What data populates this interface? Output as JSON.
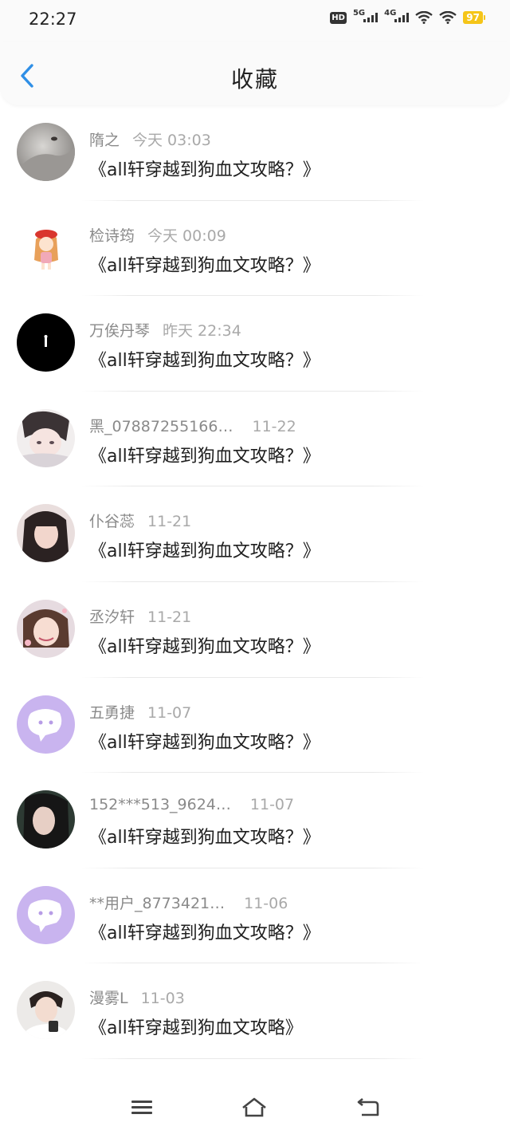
{
  "status_bar": {
    "time": "22:27",
    "hd_label": "HD",
    "sim1_label": "5G",
    "sim2_label": "4G",
    "battery": "97",
    "icons": [
      "hd-voice-icon",
      "signal-5g-icon",
      "signal-4g-icon",
      "wifi-icon",
      "hotspot-icon",
      "battery-icon"
    ]
  },
  "header": {
    "back_icon": "chevron-left-icon",
    "title": "收藏",
    "accent_color": "#2f8fe6"
  },
  "items": [
    {
      "user": "隋之",
      "time": "今天 03:03",
      "title": "《all轩穿越到狗血文攻略？》",
      "avatar": "photo-gray-cat"
    },
    {
      "user": "检诗筠",
      "time": "今天 00:09",
      "title": "《all轩穿越到狗血文攻略？》",
      "avatar": "cartoon-girl"
    },
    {
      "user": "万俟丹琴",
      "time": "昨天 22:34",
      "title": "《all轩穿越到狗血文攻略？》",
      "avatar": "black-circle"
    },
    {
      "user": "黑_07887255166…",
      "time": "11-22",
      "title": "《all轩穿越到狗血文攻略？》",
      "avatar": "anime-girl"
    },
    {
      "user": "仆谷蕊",
      "time": "11-21",
      "title": "《all轩穿越到狗血文攻略？》",
      "avatar": "photo-girl-dark-hair"
    },
    {
      "user": "丞汐轩",
      "time": "11-21",
      "title": "《all轩穿越到狗血文攻略？》",
      "avatar": "photo-girl-smile"
    },
    {
      "user": "五勇捷",
      "time": "11-07",
      "title": "《all轩穿越到狗血文攻略？》",
      "avatar": "default-chat-bubble"
    },
    {
      "user": "152***513_9624…",
      "time": "11-07",
      "title": "《all轩穿越到狗血文攻略？》",
      "avatar": "photo-girl-green"
    },
    {
      "user": "**用户_8773421…",
      "time": "11-06",
      "title": "《all轩穿越到狗血文攻略？》",
      "avatar": "default-chat-bubble"
    },
    {
      "user": "漫雾L",
      "time": "11-03",
      "title": "《all轩穿越到狗血文攻略》",
      "avatar": "photo-boy"
    }
  ],
  "bottom_nav": {
    "icons": [
      "menu-icon",
      "home-icon",
      "back-icon"
    ]
  }
}
